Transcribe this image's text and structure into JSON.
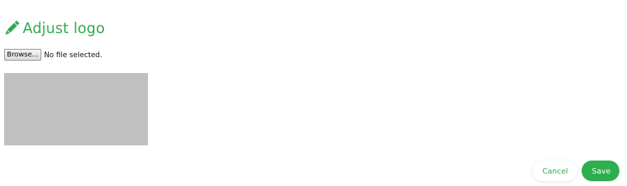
{
  "dialog": {
    "title": "Adjust logo",
    "title_icon": "pencil-icon",
    "accent_color": "#2eae4f"
  },
  "file_input": {
    "browse_label": "Browse...",
    "status_text": "No file selected."
  },
  "preview": {
    "placeholder_color": "#c0c0c0"
  },
  "footer": {
    "cancel_label": "Cancel",
    "save_label": "Save"
  }
}
